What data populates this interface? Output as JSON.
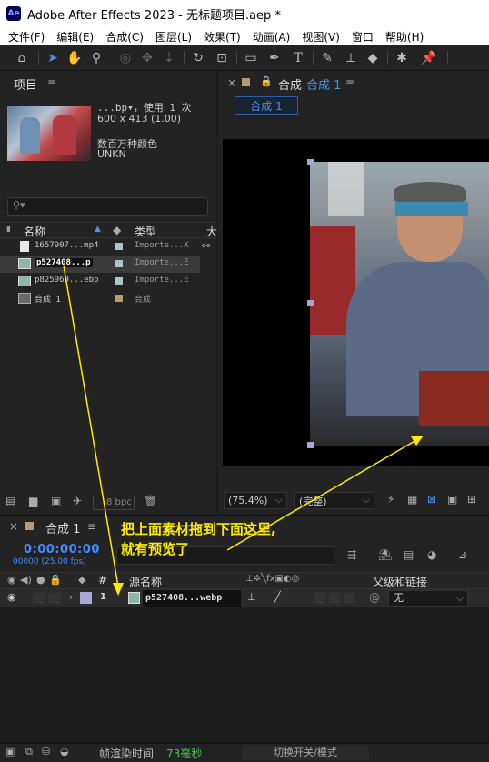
{
  "window": {
    "title": "Adobe After Effects 2023 - 无标题项目.aep *",
    "app_icon": "Ae"
  },
  "menu": [
    "文件(F)",
    "编辑(E)",
    "合成(C)",
    "图层(L)",
    "效果(T)",
    "动画(A)",
    "视图(V)",
    "窗口",
    "帮助(H)"
  ],
  "project": {
    "title": "项目",
    "item_name": "...bp▾，使用 1 次",
    "dimensions": "600 x 413 (1.00)",
    "colors": "数百万种颜色",
    "codec": "UNKN",
    "col_name": "名称",
    "col_type": "类型",
    "col_size": "大",
    "bpc": "8 bpc",
    "items": [
      {
        "name": "1657907...mp4",
        "type": "Importe...X",
        "swatch": "#a8c8c8"
      },
      {
        "name": "p527408...p",
        "type": "Importe...E",
        "swatch": "#a8c8c8"
      },
      {
        "name": "p825969...ebp",
        "type": "Importe...E",
        "swatch": "#a8c8c8"
      },
      {
        "name": "合成 1",
        "type": "合成",
        "swatch": "#b89a72"
      }
    ]
  },
  "viewer": {
    "panel_title": "合成",
    "comp_link": "合成 1",
    "tab": "合成 1",
    "zoom": "(75.4%)",
    "quality": "(完整)"
  },
  "timeline": {
    "tab": "合成 1",
    "timecode": "0:00:00:00",
    "frames": "00000 (25.00 fps)",
    "col_hash": "#",
    "col_source": "源名称",
    "col_parent": "父级和链接",
    "layer": {
      "index": "1",
      "name": "p527408...webp",
      "parent": "无"
    },
    "render_label": "帧渲染时间",
    "render_value": "73毫秒",
    "toggle": "切换开关/模式"
  },
  "annotation": "把上面素材拖到下面这里,\n就有预览了",
  "colors": {
    "accent_blue": "#3f8cff",
    "annotation_yellow": "#ffeb00",
    "handle": "#a6a9d6"
  }
}
